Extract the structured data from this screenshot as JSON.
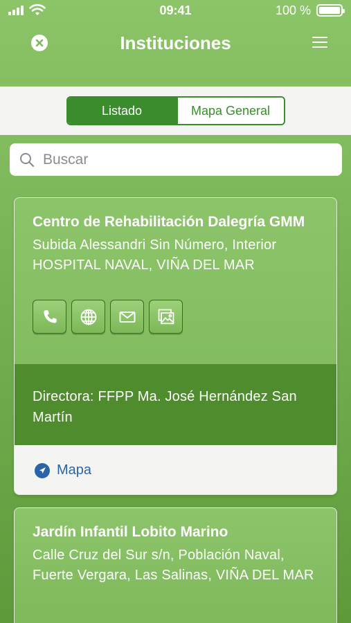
{
  "status_bar": {
    "time": "09:41",
    "battery": "100 %",
    "battery_level": 1.0
  },
  "header": {
    "title": "Instituciones",
    "close_icon": "close-circle-icon",
    "menu_icon": "hamburger-menu-icon"
  },
  "segments": {
    "items": [
      "Listado",
      "Mapa General"
    ],
    "selected": "Listado"
  },
  "search": {
    "placeholder": "Buscar",
    "value": ""
  },
  "institutions": [
    {
      "name": "Centro de Rehabilitación Dalegría GMM",
      "address": "Subida Alessandri Sin Número, Interior HOSPITAL NAVAL, VIÑA DEL MAR",
      "actions": [
        "phone-icon",
        "globe-icon",
        "mail-icon",
        "gallery-icon"
      ],
      "director": "Directora: FFPP Ma. José Hernández San Martín",
      "map_label": "Mapa"
    },
    {
      "name": "Jardín Infantil Lobito Marino",
      "address": "Calle Cruz del Sur s/n, Población Naval, Fuerte Vergara, Las Salinas, VIÑA DEL MAR"
    }
  ],
  "colors": {
    "background": "#7cb758",
    "accent": "#3a8c2c",
    "director_band": "#4f8c2d",
    "link": "#2a64a6"
  }
}
